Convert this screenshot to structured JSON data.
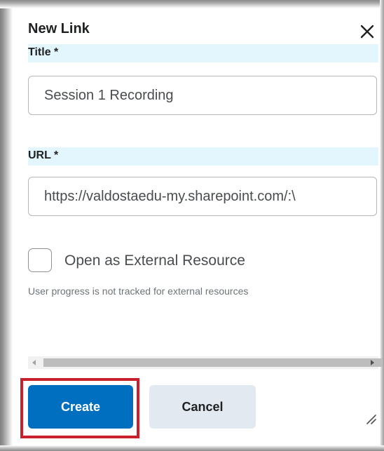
{
  "dialog": {
    "title": "New Link",
    "close_icon": "close-icon"
  },
  "title_field": {
    "label": "Title *",
    "value": "Session 1 Recording"
  },
  "url_field": {
    "label": "URL *",
    "value": "https://valdostaedu-my.sharepoint.com/:\\"
  },
  "external_resource": {
    "checkbox_label": "Open as External Resource",
    "checked": false,
    "help_text": "User progress is not tracked for external resources"
  },
  "buttons": {
    "create_label": "Create",
    "cancel_label": "Cancel"
  },
  "colors": {
    "primary": "#006fbf",
    "secondary": "#e3e9f1",
    "label_band": "#e3f6fd",
    "highlight": "#c8202d"
  }
}
